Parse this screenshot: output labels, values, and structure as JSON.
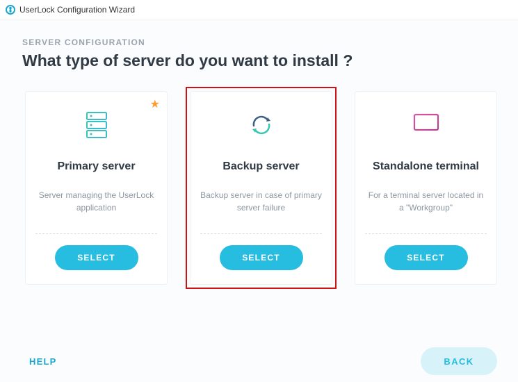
{
  "window": {
    "title": "UserLock Configuration Wizard"
  },
  "page": {
    "kicker": "SERVER CONFIGURATION",
    "heading": "What type of server do you want to install ?"
  },
  "cards": {
    "primary": {
      "title": "Primary server",
      "desc": "Server managing the UserLock application",
      "button": "SELECT",
      "recommended": true
    },
    "backup": {
      "title": "Backup server",
      "desc": "Backup server in case of primary server failure",
      "button": "SELECT",
      "highlighted": true
    },
    "standalone": {
      "title": "Standalone terminal",
      "desc": "For a terminal server located in a \"Workgroup\"",
      "button": "SELECT"
    }
  },
  "footer": {
    "help": "HELP",
    "back": "BACK"
  },
  "colors": {
    "accent": "#26bde0",
    "highlight_border": "#cc1414",
    "star": "#ff9b31"
  }
}
